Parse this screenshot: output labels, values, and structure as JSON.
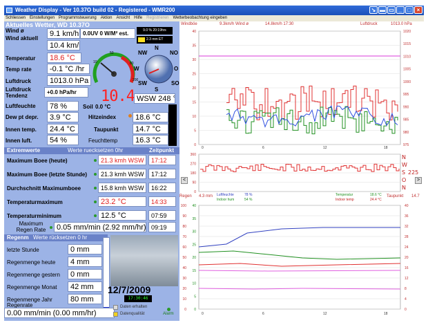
{
  "window": {
    "title": "Weather Display - Ver 10.37O build 02 - Registered - WMR200",
    "menu": [
      "Schliessen",
      "Einstellungen",
      "Programmsteuerung",
      "Aktion",
      "Ansicht",
      "Hilfe",
      "Registrieren",
      "Wetterbeobachtung eingeben"
    ]
  },
  "current": {
    "header": "Aktuelles Wetter, WD 10.37O",
    "wind_avg_label": "Wind ø",
    "wind_now_label": "Wind aktuell",
    "wind_avg": "9.1 km/h",
    "wind_now": "10.4 km/h",
    "uv": "0.0UV 0 W/M² est.",
    "time_box": "9.0 % 20:19hrs",
    "et_box": "2.3 mm ET",
    "temp_label": "Temperatur",
    "temp": "18.6 °C",
    "temprate_label": "Temp rate",
    "temprate": "-0.1 °C /hr",
    "pressure_label": "Luftdruck",
    "pressure": "1013.0 hPa",
    "tendency_label": "Luftdruck Tendenz",
    "tendency": "+0.0 hPa/hr",
    "humidity_label": "Luftfeuchte",
    "humidity": "78 %",
    "dew_label": "Dew pt depr.",
    "dew": "3.9 °C",
    "intemp_label": "Innen temp.",
    "intemp": "24.4 °C",
    "inhum_label": "Innen luft.",
    "inhum": "54 %",
    "soil_label": "Soil",
    "soil": "0.0 °C",
    "heat_label": "Hitzeindex",
    "heat": "18.6 °C",
    "dewpt_label": "Taupunkt",
    "dewpt": "14.7 °C",
    "feel_label": "Feuchttemp",
    "feel": "16.3 °C",
    "wind_dir": "WSW 248 °",
    "digital": "10.4",
    "compass": [
      "N",
      "NO",
      "O",
      "SO",
      "S",
      "SW",
      "W",
      "NW"
    ]
  },
  "extremes": {
    "header": "Extremwerte",
    "reset": "Werte ruecksetzen 0hr",
    "time_header": "Zeitpunkt",
    "rows": [
      {
        "label": "Maximum Boee (heute)",
        "value": "21.3 kmh WSW",
        "time": "17:12",
        "red": true
      },
      {
        "label": "Maximum Boee (letzte Stunde)",
        "value": "21.3 kmh WSW",
        "time": "17:12",
        "red": false
      },
      {
        "label": "Durchschnitt Maximumboee",
        "value": "15.8 kmh WSW",
        "time": "16:22",
        "red": false
      },
      {
        "label": "Temperaturmaximum",
        "value": "23.2 °C",
        "time": "14:33",
        "red": true
      },
      {
        "label": "Temperaturminimum",
        "value": "12.5 °C",
        "time": "07:59",
        "red": false
      }
    ],
    "rainrate_label": "Maximum Regen Rate",
    "rainrate": "0.05 mm/min (2.92 mm/hr)",
    "rainrate_time": "09:19"
  },
  "rain": {
    "header": "Regenm",
    "reset": "Werte rücksetzen 0 hr",
    "rows": [
      {
        "label": "letzte Stunde",
        "value": "0 mm"
      },
      {
        "label": "Regenmenge heute",
        "value": "4 mm"
      },
      {
        "label": "Regenmenge gestern",
        "value": "0 mm"
      },
      {
        "label": "Regenmenge Monat",
        "value": "42 mm"
      },
      {
        "label": "Regenmenge Jahr",
        "value": "80 mm"
      }
    ],
    "rate_label": "Regenrate",
    "rate": "0.00 mm/min (0.00 mm/hr)",
    "date": "12/7/2009",
    "clock": "17:30:46",
    "status1": "Daten erhalten",
    "status2": "Datenqualität",
    "alarm": "Alarm"
  },
  "graphs": {
    "top_info": {
      "wind_label": "Windböe",
      "wind": "9.3km/h Wind ø",
      "wind2": "14.8km/h 17:30",
      "press_label": "Luftdruck",
      "press": "1013.0 hPa"
    },
    "top_left_axis": [
      "40",
      "35",
      "30",
      "25",
      "20",
      "15",
      "10",
      "5",
      "0"
    ],
    "top_right_axis": [
      "1020",
      "1015",
      "1010",
      "1005",
      "1000",
      "995",
      "990",
      "985",
      "980",
      "975"
    ],
    "dir_axis": [
      "360",
      "270",
      "180",
      "90",
      "0"
    ],
    "dir_labels": [
      "N",
      "W",
      "S",
      "O",
      "N"
    ],
    "dir_value": "225",
    "bottom_info": {
      "rain_label": "Regen",
      "rain": "4.3 mm",
      "hum_label": "Luftfeuchte",
      "hum": "78 %",
      "inhum_label": "Indoor hum",
      "inhum": "54 %",
      "temp_label": "Temperatur",
      "temp": "18.6 °C",
      "intemp_label": "Indoor temp",
      "intemp": "24.4 °C",
      "dew_label": "Taupunkt",
      "dew": "14.7"
    },
    "bottom_left_axis": [
      "100",
      "90",
      "80",
      "70",
      "60",
      "50",
      "40",
      "30",
      "20",
      "10",
      "0"
    ],
    "bottom_mid_axis": [
      "40",
      "35",
      "30",
      "25",
      "20",
      "15",
      "10",
      "5",
      "0"
    ],
    "bottom_right_axis": [
      "40",
      "36",
      "32",
      "28",
      "24",
      "20",
      "16",
      "12",
      "8",
      "4",
      "0"
    ],
    "x_ticks": [
      "0",
      "6",
      "12",
      "18"
    ],
    "colors": {
      "pressure": "#e060e0",
      "wind_avg": "#3050e0",
      "wind_gust": "#e03030",
      "wind_green": "#209020",
      "temp": "#209020",
      "dew": "#e03030",
      "hum": "#3040c0"
    }
  }
}
